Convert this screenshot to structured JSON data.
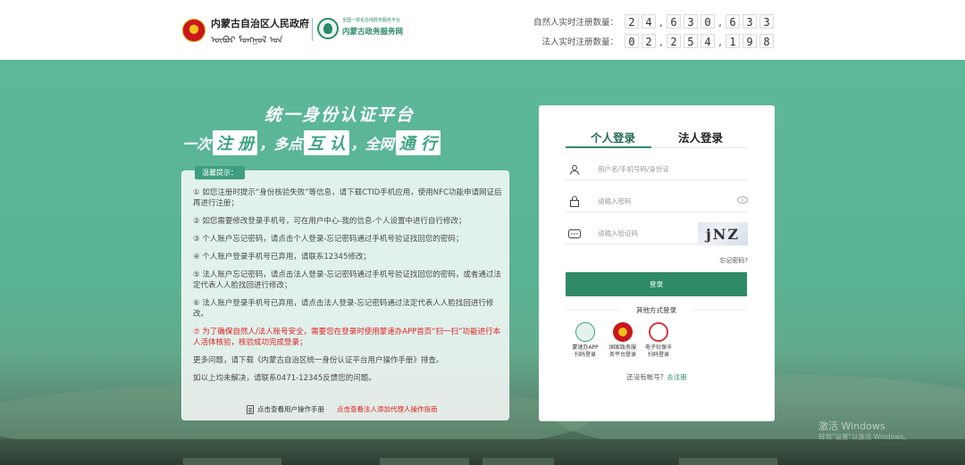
{
  "header": {
    "gov_title": "内蒙古自治区人民政府",
    "gov_mongolian": "ᠦᠪᠦᠷ ᠮᠣᠩᠭᠣᠯ ᠤᠨ",
    "service_small": "全国一体化在线政务服务平台",
    "service_name": "内蒙古政务服务网",
    "natural_label": "自然人实时注册数量：",
    "natural_digits": [
      "2",
      "4",
      ",",
      "6",
      "3",
      "0",
      ",",
      "6",
      "3",
      "3"
    ],
    "legal_label": "法人实时注册数量：",
    "legal_digits": [
      "0",
      "2",
      ",",
      "2",
      "5",
      "4",
      ",",
      "1",
      "9",
      "8"
    ]
  },
  "hero": {
    "slogan_main": "统一身份认证平台",
    "slogan_parts": [
      {
        "text": "一次",
        "boxed": false
      },
      {
        "text": "注 册",
        "boxed": true
      },
      {
        "text": "，多点",
        "boxed": false
      },
      {
        "text": "互 认",
        "boxed": true
      },
      {
        "text": "，全网",
        "boxed": false
      },
      {
        "text": "通 行",
        "boxed": true
      }
    ]
  },
  "tips": {
    "title": "温馨提示：",
    "items": [
      {
        "text": "① 如您注册时提示“身份核验失败”等信息，请下载CTID手机应用，使用NFC功能申请网证后再进行注册；",
        "red": false
      },
      {
        "text": "② 如您需要修改登录手机号，可在用户中心-我的信息-个人设置中进行自行修改；",
        "red": false
      },
      {
        "text": "③ 个人账户忘记密码，请点击个人登录-忘记密码通过手机号验证找回您的密码；",
        "red": false
      },
      {
        "text": "④ 个人账户登录手机号已弃用，请联系12345修改；",
        "red": false
      },
      {
        "text": "⑤ 法人账户忘记密码，请点击法人登录-忘记密码通过手机号验证找回您的密码，或者通过法定代表人人脸找回进行修改；",
        "red": false
      },
      {
        "text": "⑥ 法人账户登录手机号已弃用，请点击法人登录-忘记密码通过法定代表人人脸找回进行修改。",
        "red": false
      },
      {
        "text": "⑦ 为了确保自然人/法人账号安全，需要您在登录时使用蒙速办APP首页“扫一扫”功能进行本人活体核验，核验成功完成登录；",
        "red": true
      },
      {
        "text": "更多问题，请下载《内蒙古自治区统一身份认证平台用户操作手册》排查。",
        "red": false
      },
      {
        "text": "如以上均未解决，请联系0471-12345反馈您的问题。",
        "red": false
      }
    ],
    "manual_link": "点击查看用户操作手册",
    "agent_link": "点击查看法人添加代理人操作指南"
  },
  "login": {
    "tab_personal": "个人登录",
    "tab_legal": "法人登录",
    "username_placeholder": "用户名/手机号码/身份证",
    "password_placeholder": "请输入密码",
    "captcha_placeholder": "请输入验证码",
    "captcha_text": "jNZ",
    "forgot": "忘记密码?",
    "login_button": "登录",
    "other_methods": "其他方式登录",
    "methods": [
      {
        "label_1": "蒙速办APP",
        "label_2": "扫码登录"
      },
      {
        "label_1": "国家政务服",
        "label_2": "务平台登录"
      },
      {
        "label_1": "电子社保卡",
        "label_2": "扫码登录"
      }
    ],
    "no_account": "还没有帐号？",
    "register": "去注册"
  },
  "watermark": {
    "line1": "激活 Windows",
    "line2": "转到\"设置\"以激活 Windows。"
  },
  "colors": {
    "accent": "#2f8a68",
    "background_green": "#5cb899",
    "alert_red": "#e02020"
  }
}
